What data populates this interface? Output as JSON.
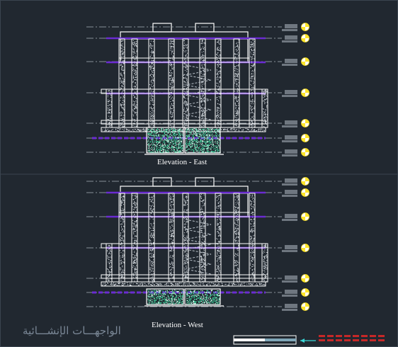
{
  "drawing": {
    "title_east": "Elevation - East",
    "title_west": "Elevation - West",
    "watermark": "الواجهـــات الإنشـــائية",
    "colors": {
      "background": "#212830",
      "lines": "#ffffff",
      "dashed": "#a9b2bc",
      "slab": "#6a2bd1",
      "hatch": "#3fd7a0",
      "marker": "#ffe52a",
      "label_box": "#6f7780",
      "red_mark": "#c62828",
      "cyan_arrow": "#39d5d5"
    }
  }
}
